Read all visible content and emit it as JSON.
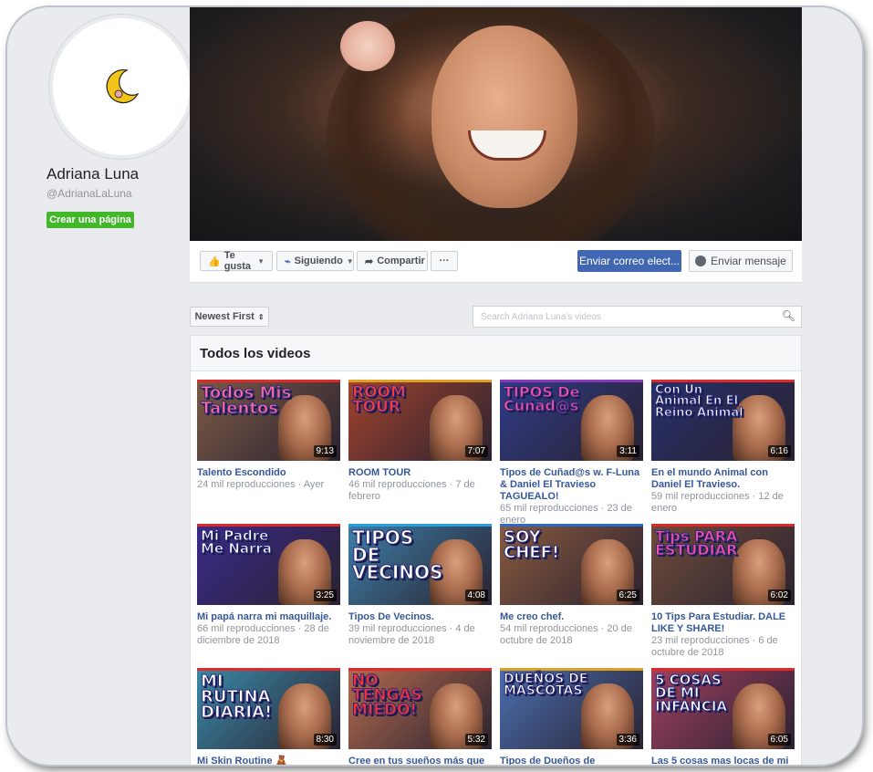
{
  "page": {
    "name": "Adriana Luna",
    "handle": "@AdrianaLaLuna",
    "create_page": "Crear una página"
  },
  "actions": {
    "like": "Te gusta",
    "following": "Siguiendo",
    "share": "Compartir",
    "more": "···",
    "email": "Enviar correo elect...",
    "message": "Enviar mensaje"
  },
  "filters": {
    "sort": "Newest First",
    "search_placeholder": "Search Adriana Luna's videos"
  },
  "section_title": "Todos los videos",
  "videos": [
    {
      "thumb_text": "Todos Mis Talentos",
      "duration": "9:13",
      "title": "Talento Escondido",
      "meta": "24 mil reproducciones · Ayer",
      "bg": "#7c5a46",
      "text_color": "#ff6a9a",
      "bar": "#e02a2a"
    },
    {
      "thumb_text": "ROOM TOUR",
      "duration": "7:07",
      "title": "ROOM TOUR",
      "meta": "46 mil reproducciones · 7 de febrero",
      "bg": "#a1432d",
      "text_color": "#ff3b3b",
      "bar": "#e0a020"
    },
    {
      "thumb_text": "TIPOS De Cuñad@s",
      "duration": "3:11",
      "title": "Tipos de Cuñad@s w. F-Luna & Daniel El Travieso TAGUEALO!",
      "meta": "65 mil reproducciones · 23 de enero",
      "bg": "#2e3b86",
      "text_color": "#ff4fa0",
      "bar": "#8a3ab8"
    },
    {
      "thumb_text": "Con Un Animal En El Reino Animal",
      "duration": "6:16",
      "title": "En el mundo Animal con Daniel El Travieso.",
      "meta": "59 mil reproducciones · 12 de enero",
      "bg": "#27306b",
      "text_color": "#ffffff",
      "bar": "#e02a2a"
    },
    {
      "thumb_text": "Mi Padre Me Narra",
      "duration": "3:25",
      "title": "Mi papá narra mi maquillaje.",
      "meta": "66 mil reproducciones · 28 de diciembre de 2018",
      "bg": "#3a2a8a",
      "text_color": "#ffffff",
      "bar": "#e02a2a"
    },
    {
      "thumb_text": "TIPOS DE VECINOS",
      "duration": "4:08",
      "title": "Tipos De Vecinos.",
      "meta": "39 mil reproducciones · 4 de noviembre de 2018",
      "bg": "#3d7fa8",
      "text_color": "#ffffff",
      "bar": "#2aa0e0"
    },
    {
      "thumb_text": "SOY CHEF!",
      "duration": "6:25",
      "title": "Me creo chef.",
      "meta": "54 mil reproducciones · 20 de octubre de 2018",
      "bg": "#8a5a3e",
      "text_color": "#ffffff",
      "bar": "#2a6ac8"
    },
    {
      "thumb_text": "Tips PARA ESTUDIAR",
      "duration": "6:02",
      "title": "10 Tips Para Estudiar. DALE LIKE Y SHARE!",
      "meta": "23 mil reproducciones · 6 de octubre de 2018",
      "bg": "#6f4c3a",
      "text_color": "#ff4fa0",
      "bar": "#e02a2a"
    },
    {
      "thumb_text": "MI RUTINA DIARIA!",
      "duration": "8:30",
      "title": "Mi Skin Routine 🧸",
      "meta": "",
      "bg": "#3a8aa8",
      "text_color": "#ffffff",
      "bar": "#e02a2a"
    },
    {
      "thumb_text": "NO TENGAS MIEDO!",
      "duration": "5:32",
      "title": "Cree en tus sueños más que en",
      "meta": "",
      "bg": "#b26a4e",
      "text_color": "#ff3030",
      "bar": "#e02a2a"
    },
    {
      "thumb_text": "DUEÑOS DE MASCOTAS",
      "duration": "3:36",
      "title": "Tipos de Dueños de Mascotas.",
      "meta": "",
      "bg": "#4a6fb0",
      "text_color": "#ffffff",
      "bar": "#e0a020"
    },
    {
      "thumb_text": "5 COSAS DE MI INFANCIA",
      "duration": "6:05",
      "title": "Las 5 cosas mas locas de mi",
      "meta": "",
      "bg": "#a04060",
      "text_color": "#ffffff",
      "bar": "#e02a2a"
    }
  ]
}
